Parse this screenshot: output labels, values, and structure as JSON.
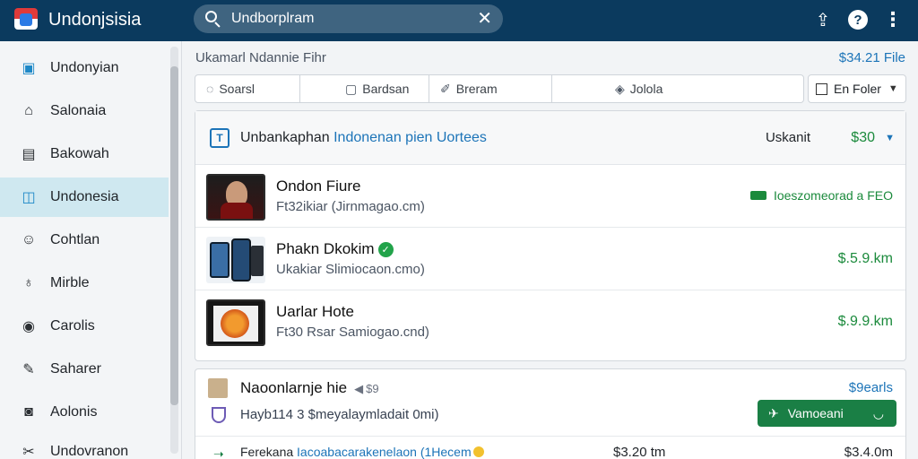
{
  "app": {
    "name": "Undonjsisia"
  },
  "search": {
    "value": "Undborplram",
    "placeholder": "Undborplram"
  },
  "sidebar": {
    "items": [
      {
        "label": "Undonyian",
        "icon": "calendar-icon",
        "active": false
      },
      {
        "label": "Salonaia",
        "icon": "home-icon",
        "active": false
      },
      {
        "label": "Bakowah",
        "icon": "book-icon",
        "active": false
      },
      {
        "label": "Undonesia",
        "icon": "folder-icon",
        "active": true
      },
      {
        "label": "Cohtlan",
        "icon": "users-icon",
        "active": false
      },
      {
        "label": "Mirble",
        "icon": "pin-icon",
        "active": false
      },
      {
        "label": "Carolis",
        "icon": "tag-icon",
        "active": false
      },
      {
        "label": "Saharer",
        "icon": "edit-icon",
        "active": false
      },
      {
        "label": "Aolonis",
        "icon": "chat-icon",
        "active": false
      },
      {
        "label": "Undovranon",
        "icon": "tool-icon",
        "active": false
      }
    ]
  },
  "main": {
    "breadcrumb": "Ukamarl Ndannie Fihr",
    "total": "$34.21 File",
    "filters": [
      {
        "label": "Soarsl",
        "icon": "chat-icon"
      },
      {
        "label": "Bardsan",
        "icon": "doc-icon"
      },
      {
        "label": "Breram",
        "icon": "pen-icon"
      },
      {
        "label": "Jolola",
        "icon": "lock-icon"
      }
    ],
    "folder_select": "En Foler"
  },
  "card": {
    "title_plain": "Unbankaphan ",
    "title_highlight": "Indonenan pien Uortees",
    "filter_label": "Uskanit",
    "amount": "$30",
    "rows": [
      {
        "title": "Ondon Fiure",
        "subtitle": "Ft32ikiar (Jirnmagao.cm)",
        "status": "Ioeszomeorad a FEO"
      },
      {
        "title": "Phakn Dkokim",
        "subtitle": "Ukakiar Slimiocaon.cmo)",
        "price": "$.5.9.km",
        "verified": true
      },
      {
        "title": "Uarlar Hote",
        "subtitle": "Ft30 Rsar Samiogao.cnd)",
        "price": "$.9.9.km"
      }
    ]
  },
  "card2": {
    "title": "Naoonlarnje hie",
    "play_label": "$9",
    "link": "$9earls",
    "subtitle": "Hayb114 3 $meyalaymladait 0mi)",
    "button_label": "Vamoeani",
    "footer_plain": "Ferekana ",
    "footer_highlight": "Iacoabacarakenelaon (1Hecem",
    "price1": "$3.20 tm",
    "price2": "$3.4.0m"
  },
  "colors": {
    "topbar": "#0b3a5e",
    "accent": "#1c74b8",
    "success": "#1b8a3c",
    "active_nav": "#cfe8f0"
  }
}
